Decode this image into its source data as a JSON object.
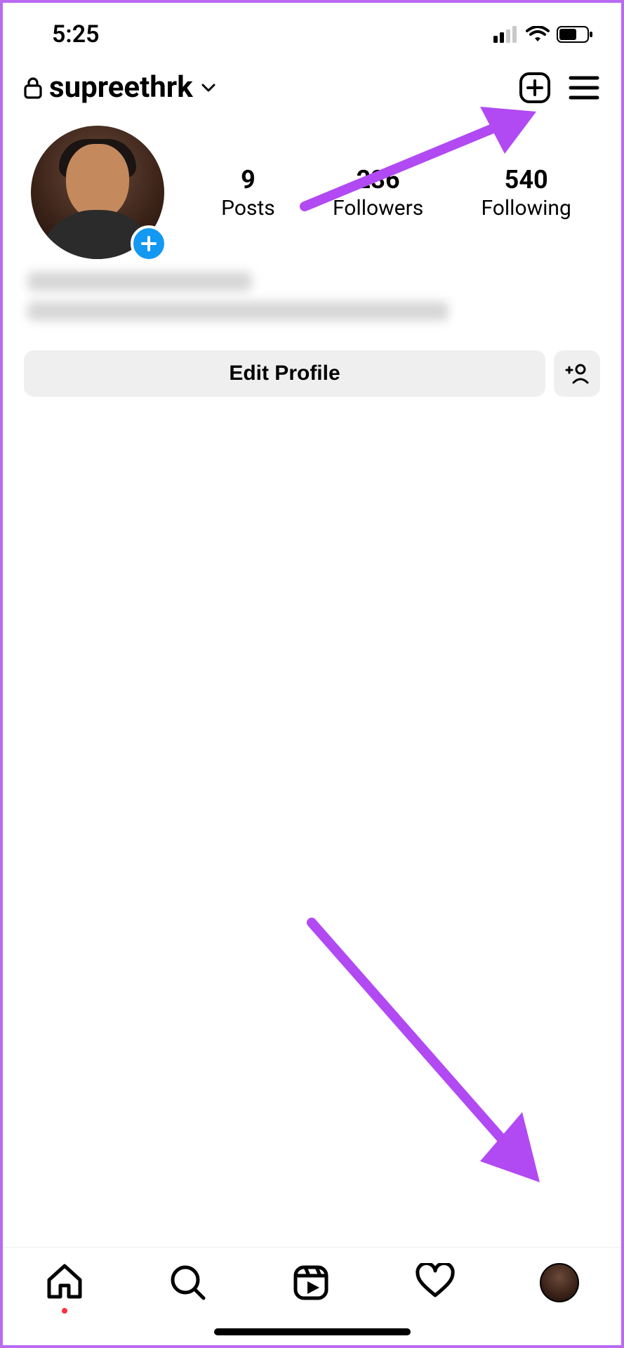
{
  "status": {
    "time": "5:25"
  },
  "header": {
    "username": "supreethrk"
  },
  "stats": {
    "posts": {
      "count": "9",
      "label": "Posts"
    },
    "followers": {
      "count": "236",
      "label": "Followers"
    },
    "following": {
      "count": "540",
      "label": "Following"
    }
  },
  "actions": {
    "edit_label": "Edit Profile"
  },
  "annotation": {
    "arrow_color": "#b14af2"
  }
}
